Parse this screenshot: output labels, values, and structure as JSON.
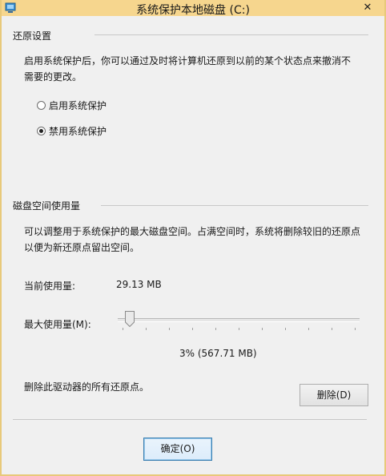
{
  "window": {
    "title": "系统保护本地磁盘 (C:)",
    "close_glyph": "✕"
  },
  "restore": {
    "heading": "还原设置",
    "description": "启用系统保护后，你可以通过及时将计算机还原到以前的某个状态点来撤消不需要的更改。",
    "options": [
      {
        "label": "启用系统保护",
        "selected": false
      },
      {
        "label": "禁用系统保护",
        "selected": true
      }
    ]
  },
  "disk": {
    "heading": "磁盘空间使用量",
    "description": "可以调整用于系统保护的最大磁盘空间。占满空间时，系统将删除较旧的还原点以便为新还原点留出空间。",
    "current_label": "当前使用量:",
    "current_value": "29.13 MB",
    "max_label": "最大使用量(M):",
    "max_percent": 3,
    "max_value": "3% (567.71 MB)",
    "delete_text": "删除此驱动器的所有还原点。",
    "delete_button": "删除(D)"
  },
  "footer": {
    "ok_button": "确定(O)"
  },
  "colors": {
    "titlebar": "#f6d68e",
    "background": "#f0f0f0",
    "default_button_border": "#3c7fb1"
  },
  "icons": {
    "app": "system-protection-icon",
    "close": "close-icon"
  }
}
